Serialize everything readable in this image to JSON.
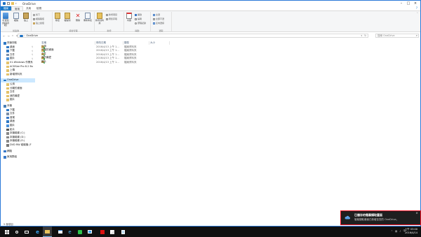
{
  "window": {
    "title": "OneDrive",
    "tabs": [
      "檔案",
      "常用",
      "共用",
      "檢視"
    ],
    "help": "?"
  },
  "ribbon": {
    "clipboard": {
      "label": "剪貼簿",
      "pin": "釘選到[快速存取]",
      "copy": "複製",
      "paste": "貼上",
      "cut": "剪下",
      "copy_path": "複製路徑",
      "paste_shortcut": "貼上捷徑"
    },
    "organize": {
      "label": "組合管理",
      "move_to": "移至",
      "copy_to": "複製到",
      "delete": "刪除",
      "rename": "重新命名"
    },
    "new": {
      "label": "新增",
      "new_folder": "新增資料夾",
      "new_item": "新增項目",
      "easy_access": "輕鬆存取"
    },
    "open": {
      "label": "開啟",
      "properties": "內容",
      "open": "開啟",
      "edit": "編輯",
      "history": "歷程記錄"
    },
    "select": {
      "label": "選取",
      "select_all": "全選",
      "select_none": "全部不選",
      "invert": "反向選擇"
    }
  },
  "address": {
    "path": "OneDrive",
    "search_placeholder": "搜尋 OneDrive"
  },
  "nav": {
    "items": [
      {
        "label": "快速存取",
        "icon": "star-icon",
        "indent": 0,
        "pin": false
      },
      {
        "label": "桌面",
        "icon": "desktop-icon",
        "indent": 1,
        "pin": true
      },
      {
        "label": "下載",
        "icon": "download-icon",
        "indent": 1,
        "pin": true
      },
      {
        "label": "文件",
        "icon": "document-icon",
        "indent": 1,
        "pin": true
      },
      {
        "label": "圖片",
        "icon": "picture-icon",
        "indent": 1,
        "pin": true
      },
      {
        "label": "01.Windows 作業系",
        "icon": "folder-icon",
        "indent": 1,
        "pin": false
      },
      {
        "label": "ACDSee Pro 8.2 Bu",
        "icon": "folder-icon",
        "indent": 1,
        "pin": false
      },
      {
        "label": "上傳",
        "icon": "folder-icon",
        "indent": 1,
        "pin": false
      },
      {
        "label": "新增資料夾",
        "icon": "folder-icon",
        "indent": 1,
        "pin": false
      },
      {
        "label": "",
        "icon": "",
        "indent": 0,
        "pin": false
      },
      {
        "label": "OneDrive",
        "icon": "onedrive-icon",
        "indent": 0,
        "pin": false,
        "selected": true
      },
      {
        "label": "公用",
        "icon": "folder-icon",
        "indent": 1,
        "pin": false
      },
      {
        "label": "分離的畫面",
        "icon": "folder-icon",
        "indent": 1,
        "pin": false
      },
      {
        "label": "文件",
        "icon": "folder-icon",
        "indent": 1,
        "pin": false
      },
      {
        "label": "我的最愛",
        "icon": "folder-icon",
        "indent": 1,
        "pin": false
      },
      {
        "label": "圖片",
        "icon": "folder-icon",
        "indent": 1,
        "pin": false
      },
      {
        "label": "",
        "icon": "",
        "indent": 0,
        "pin": false
      },
      {
        "label": "本機",
        "icon": "pc-icon",
        "indent": 0,
        "pin": false
      },
      {
        "label": "下載",
        "icon": "download-icon",
        "indent": 1,
        "pin": false
      },
      {
        "label": "文件",
        "icon": "document-icon",
        "indent": 1,
        "pin": false
      },
      {
        "label": "音樂",
        "icon": "music-icon",
        "indent": 1,
        "pin": false
      },
      {
        "label": "桌面",
        "icon": "desktop-icon",
        "indent": 1,
        "pin": false
      },
      {
        "label": "圖片",
        "icon": "picture-icon",
        "indent": 1,
        "pin": false
      },
      {
        "label": "影片",
        "icon": "video-icon",
        "indent": 1,
        "pin": false
      },
      {
        "label": "本機磁碟 (C:)",
        "icon": "drive-icon",
        "indent": 1,
        "pin": false
      },
      {
        "label": "本機磁碟 (D:)",
        "icon": "drive-icon",
        "indent": 1,
        "pin": false
      },
      {
        "label": "本機磁碟 (E:)",
        "icon": "drive-icon",
        "indent": 1,
        "pin": false
      },
      {
        "label": "DVD RW 磁碟機 (F",
        "icon": "dvd-icon",
        "indent": 1,
        "pin": false
      },
      {
        "label": "",
        "icon": "",
        "indent": 0,
        "pin": false
      },
      {
        "label": "網路",
        "icon": "network-icon",
        "indent": 0,
        "pin": false
      },
      {
        "label": "",
        "icon": "",
        "indent": 0,
        "pin": false
      },
      {
        "label": "家用群組",
        "icon": "homegroup-icon",
        "indent": 0,
        "pin": false
      }
    ]
  },
  "files": {
    "columns": [
      "名稱",
      "修改日期",
      "類型",
      "大小"
    ],
    "rows": [
      {
        "name": "公用",
        "date": "2016/4/13 上午 1...",
        "type": "檔案資料夾"
      },
      {
        "name": "分離的畫面",
        "date": "2016/4/13 上午 1...",
        "type": "檔案資料夾"
      },
      {
        "name": "文件",
        "date": "2016/4/13 上午 1...",
        "type": "檔案資料夾"
      },
      {
        "name": "我的最愛",
        "date": "2016/4/13 上午 1...",
        "type": "檔案資料夾"
      },
      {
        "name": "圖片",
        "date": "2016/4/13 上午 1...",
        "type": "檔案資料夾"
      }
    ]
  },
  "status": {
    "count": "5 個項目"
  },
  "toast": {
    "title": "已儲存的螢幕擷取畫面",
    "body": "螢幕擷取畫面已新增至您的 OneDrive。",
    "close": "×"
  },
  "taskbar": {
    "time": "上午 03:00",
    "date": "2016/4/14",
    "ime": "中"
  },
  "colors": {
    "accent": "#1979ca",
    "toast_border": "#e81123",
    "selection": "#cce8ff",
    "taskbar": "#101010"
  }
}
